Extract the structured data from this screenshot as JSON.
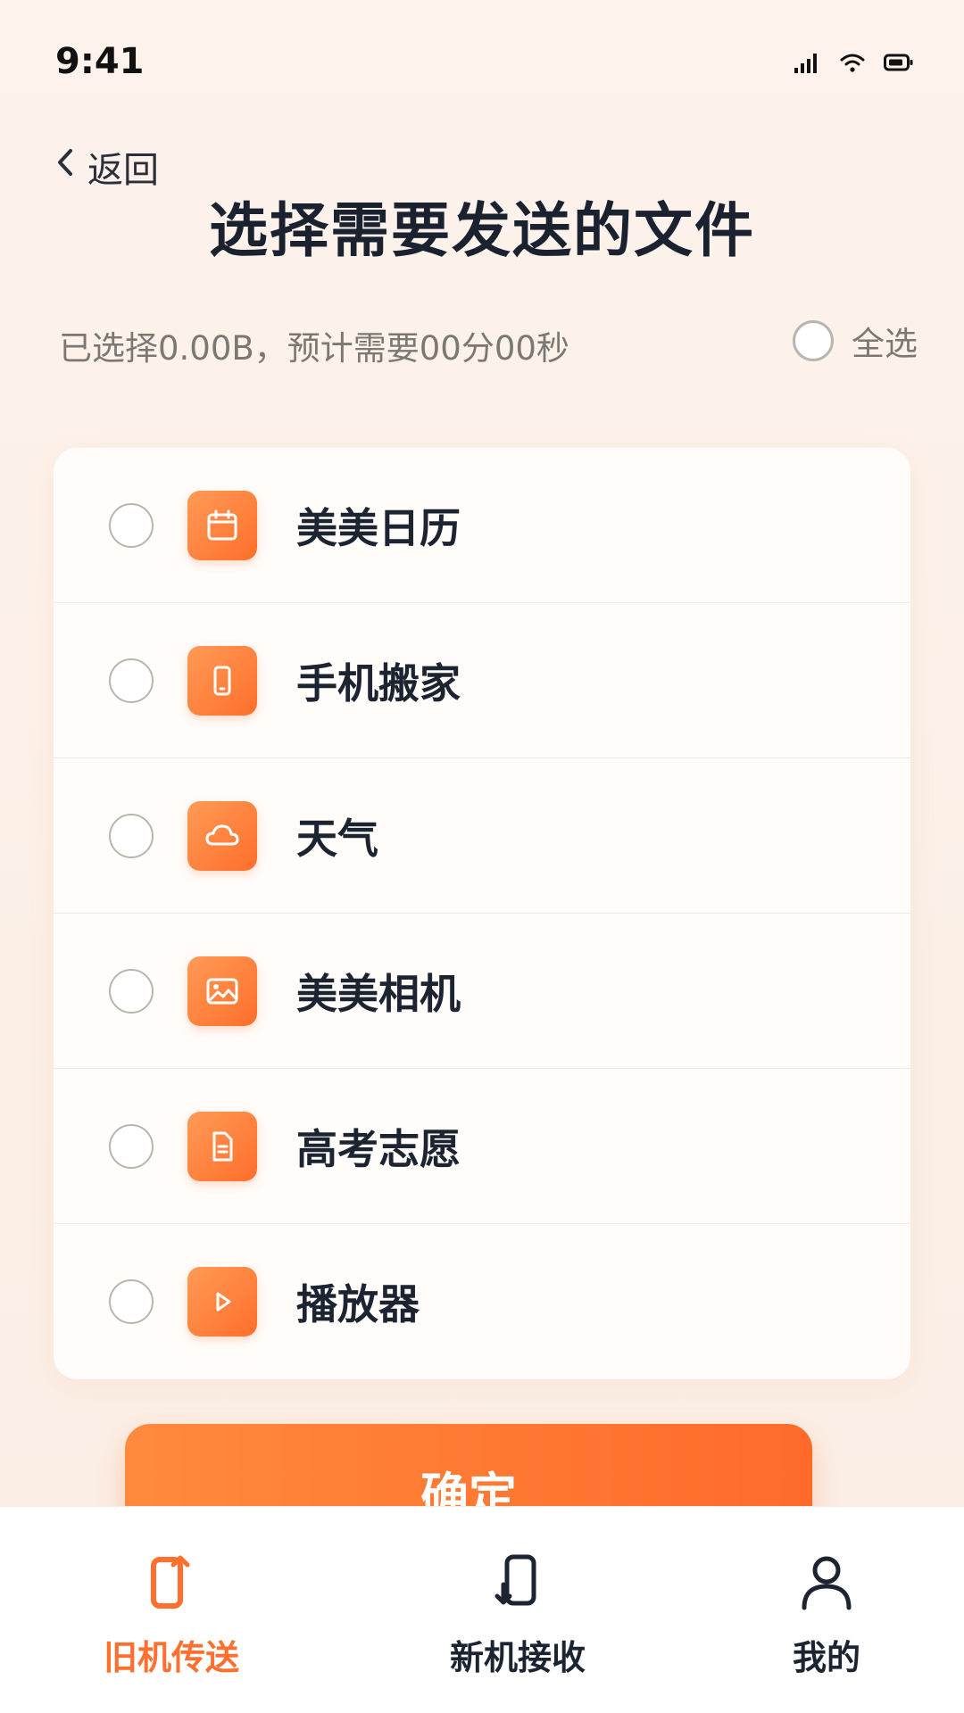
{
  "status_bar": {
    "time": "9:41"
  },
  "header": {
    "back_label": "返回",
    "title": "选择需要发送的文件"
  },
  "summary": {
    "text": "已选择0.00B，预计需要00分00秒",
    "select_all_label": "全选"
  },
  "items": [
    {
      "name": "美美日历",
      "icon": "calendar-icon"
    },
    {
      "name": "手机搬家",
      "icon": "phone-icon"
    },
    {
      "name": "天气",
      "icon": "cloud-icon"
    },
    {
      "name": "美美相机",
      "icon": "image-icon"
    },
    {
      "name": "高考志愿",
      "icon": "document-icon"
    },
    {
      "name": "播放器",
      "icon": "play-icon"
    }
  ],
  "confirm_label": "确定",
  "tabbar": {
    "tabs": [
      {
        "label": "旧机传送",
        "icon": "old-phone-send-icon",
        "active": true
      },
      {
        "label": "新机接收",
        "icon": "new-phone-receive-icon",
        "active": false
      },
      {
        "label": "我的",
        "icon": "user-icon",
        "active": false
      }
    ]
  },
  "colors": {
    "accent": "#ff6f2d",
    "accent_light": "#ff9b56",
    "text_primary": "#1c2331",
    "text_secondary": "#7b7772"
  }
}
